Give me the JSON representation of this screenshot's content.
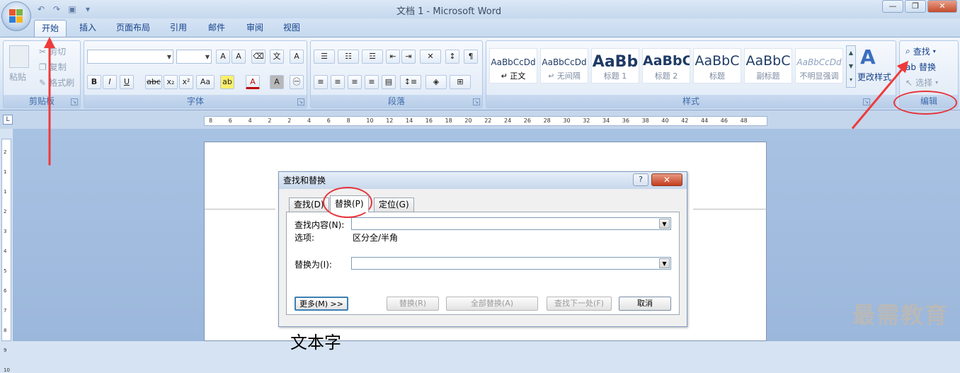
{
  "window": {
    "title": "文档 1 - Microsoft Word",
    "controls": [
      "minimize",
      "restore",
      "close"
    ]
  },
  "qat": {
    "icons": [
      "undo-icon",
      "redo-icon",
      "save-icon",
      "customize-icon"
    ]
  },
  "tabs": [
    {
      "label": "开始",
      "active": true
    },
    {
      "label": "插入"
    },
    {
      "label": "页面布局"
    },
    {
      "label": "引用"
    },
    {
      "label": "邮件"
    },
    {
      "label": "审阅"
    },
    {
      "label": "视图"
    }
  ],
  "ribbon": {
    "clipboard": {
      "label": "剪贴板",
      "paste": "粘贴",
      "cut": "剪切",
      "copy": "复制",
      "format_painter": "格式刷"
    },
    "font": {
      "label": "字体",
      "font_name": "",
      "font_size": ""
    },
    "paragraph": {
      "label": "段落"
    },
    "styles": {
      "label": "样式",
      "items": [
        {
          "sample": "AaBbCcDd",
          "name": "↵ 正文"
        },
        {
          "sample": "AaBbCcDd",
          "name": "↵ 无间隔"
        },
        {
          "sample": "AaBb",
          "name": "标题 1"
        },
        {
          "sample": "AaBbC",
          "name": "标题 2"
        },
        {
          "sample": "AaBbC",
          "name": "标题"
        },
        {
          "sample": "AaBbC",
          "name": "副标题"
        },
        {
          "sample": "AaBbCcDd",
          "name": "不明显强调"
        }
      ],
      "change_styles": "更改样式"
    },
    "editing": {
      "label": "编辑",
      "find": "查找",
      "replace": "替换",
      "select": "选择"
    }
  },
  "ruler": {
    "h_ticks": [
      "8",
      "6",
      "4",
      "2",
      "2",
      "4",
      "6",
      "8",
      "10",
      "12",
      "14",
      "16",
      "18",
      "20",
      "22",
      "24",
      "26",
      "28",
      "30",
      "32",
      "34",
      "36",
      "38",
      "40",
      "42",
      "44",
      "46",
      "48"
    ],
    "v_ticks": [
      "2",
      "1",
      "1",
      "2",
      "3",
      "4",
      "5",
      "6",
      "7",
      "8",
      "9",
      "10"
    ]
  },
  "dialog": {
    "title": "查找和替换",
    "help": "?",
    "close": "✕",
    "tabs": [
      {
        "label": "查找(D)"
      },
      {
        "label": "替换(P)",
        "active": true
      },
      {
        "label": "定位(G)"
      }
    ],
    "find_label": "查找内容(N):",
    "find_value": "",
    "options_label": "选项:",
    "options_value": "区分全/半角",
    "replace_label": "替换为(I):",
    "replace_value": "",
    "buttons": {
      "more": "更多(M) >>",
      "replace": "替换(R)",
      "replace_all": "全部替换(A)",
      "find_next": "查找下一处(F)",
      "cancel": "取消"
    }
  },
  "document": {
    "text": "文本字"
  },
  "watermark": "最需教育",
  "colors": {
    "annotation": "#e8343b"
  }
}
